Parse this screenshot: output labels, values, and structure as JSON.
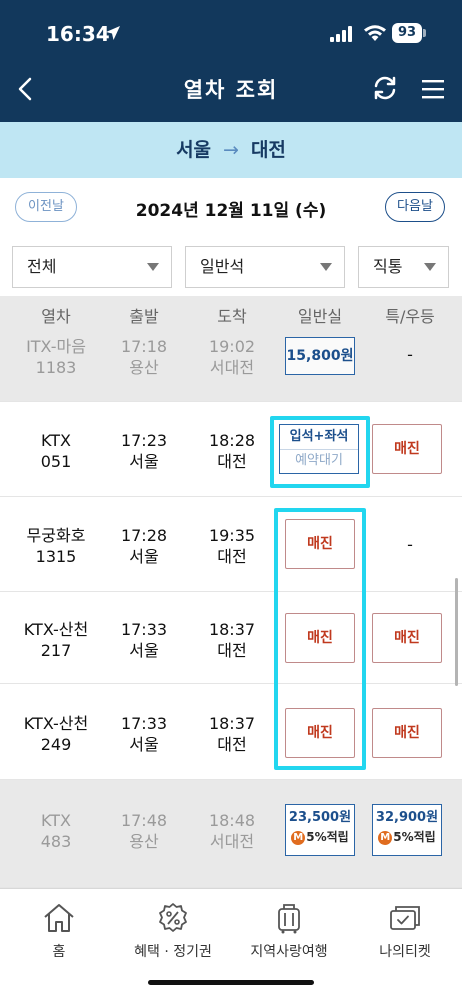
{
  "status_bar": {
    "time": "16:34",
    "battery": "93"
  },
  "header": {
    "title": "열차 조회"
  },
  "route": {
    "from": "서울",
    "arrow": "→",
    "to": "대전"
  },
  "date_bar": {
    "prev_label": "이전날",
    "date": "2024년 12월 11일 (수)",
    "next_label": "다음날"
  },
  "filters": {
    "type": "전체",
    "class": "일반석",
    "route": "직통"
  },
  "columns": {
    "train": "열차",
    "depart": "출발",
    "arrive": "도착",
    "general": "일반실",
    "special": "특/우등"
  },
  "trains": [
    {
      "name": "ITX-마음",
      "number": "1183",
      "depart_time": "17:18",
      "depart_station": "용산",
      "arrive_time": "19:02",
      "arrive_station": "서대전",
      "general": "15,800원",
      "special": "-"
    },
    {
      "name": "KTX",
      "number": "051",
      "depart_time": "17:23",
      "depart_station": "서울",
      "arrive_time": "18:28",
      "arrive_station": "대전",
      "general_line1": "입석+좌석",
      "general_line2": "예약대기",
      "special": "매진"
    },
    {
      "name": "무궁화호",
      "number": "1315",
      "depart_time": "17:28",
      "depart_station": "서울",
      "arrive_time": "19:35",
      "arrive_station": "대전",
      "general": "매진",
      "special": "-"
    },
    {
      "name": "KTX-산천",
      "number": "217",
      "depart_time": "17:33",
      "depart_station": "서울",
      "arrive_time": "18:37",
      "arrive_station": "대전",
      "general": "매진",
      "special": "매진"
    },
    {
      "name": "KTX-산천",
      "number": "249",
      "depart_time": "17:33",
      "depart_station": "서울",
      "arrive_time": "18:37",
      "arrive_station": "대전",
      "general": "매진",
      "special": "매진"
    },
    {
      "name": "KTX",
      "number": "483",
      "depart_time": "17:48",
      "depart_station": "용산",
      "arrive_time": "18:48",
      "arrive_station": "서대전",
      "general": "23,500원",
      "general_points": "5%적립",
      "special": "32,900원",
      "special_points": "5%적립",
      "badge": "M"
    }
  ],
  "tabs": [
    {
      "label": "홈",
      "icon": "home-icon"
    },
    {
      "label": "혜택 · 정기권",
      "icon": "discount-icon"
    },
    {
      "label": "지역사랑여행",
      "icon": "luggage-icon"
    },
    {
      "label": "나의티켓",
      "icon": "ticket-icon"
    }
  ],
  "colors": {
    "header_bg": "#12385c",
    "route_bg": "#bfe6f3",
    "sold_out": "#c0391e",
    "highlight": "#22d6ef",
    "price_border": "#2b65a6"
  }
}
